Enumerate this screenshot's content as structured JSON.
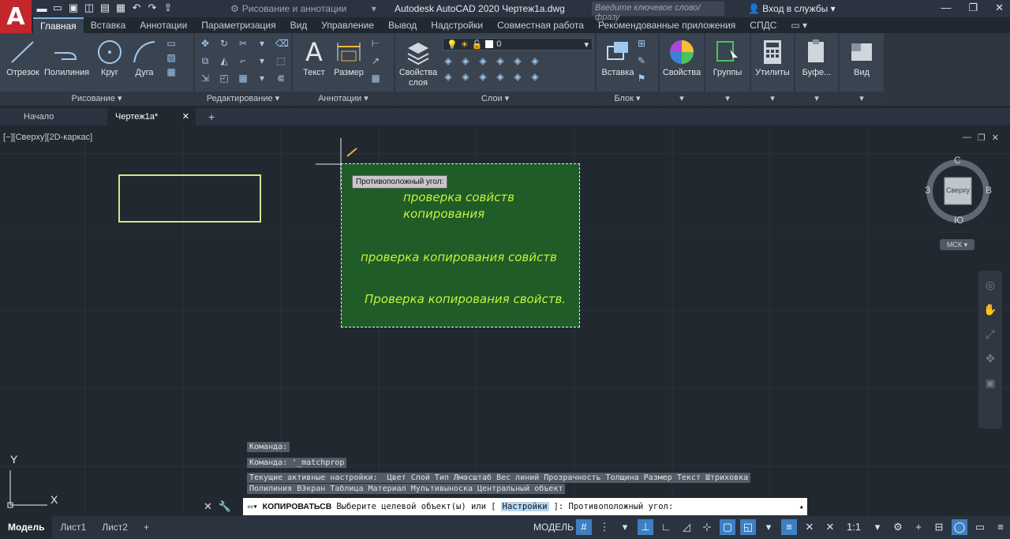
{
  "app": {
    "logo_letter": "A",
    "workspace": "Рисование и аннотации",
    "title": "Autodesk AutoCAD 2020   Чертеж1a.dwg",
    "search_placeholder": "Введите ключевое слово/фразу",
    "login": "Вход в службы"
  },
  "ribbon_tabs": [
    "Главная",
    "Вставка",
    "Аннотации",
    "Параметризация",
    "Вид",
    "Управление",
    "Вывод",
    "Надстройки",
    "Совместная работа",
    "Рекомендованные приложения",
    "СПДС"
  ],
  "ribbon": {
    "draw": {
      "title": "Рисование",
      "tools": [
        "Отрезок",
        "Полилиния",
        "Круг",
        "Дуга"
      ]
    },
    "modify": {
      "title": "Редактирование"
    },
    "annotation": {
      "title": "Аннотации",
      "tools": [
        "Текст",
        "Размер"
      ]
    },
    "layers": {
      "title": "Слои",
      "props_label": "Свойства слоя",
      "current_layer": "0"
    },
    "block": {
      "title": "Блок",
      "insert": "Вставка"
    },
    "properties": {
      "label": "Свойства"
    },
    "groups": {
      "label": "Группы"
    },
    "utilities": {
      "label": "Утилиты"
    },
    "clipboard": {
      "label": "Буфе..."
    },
    "view": {
      "label": "Вид"
    }
  },
  "doc_tabs": {
    "start": "Начало",
    "current": "Чертеж1a*"
  },
  "viewport": {
    "label": "[−][Сверху][2D-каркас]",
    "tooltip": "Противоположный угол:",
    "texts": [
      "проверка совйств копирования",
      "проверка копирования совйств",
      "Проверка копирования свойств."
    ],
    "viewcube": {
      "north": "С",
      "south": "Ю",
      "west": "З",
      "east": "В",
      "face": "Сверху"
    },
    "ucs": "МСК",
    "axis_x": "X",
    "axis_y": "Y"
  },
  "command": {
    "history": [
      "Команда:",
      "Команда: '_matchprop",
      "Текущие активные настройки:  Цвет Слой Тип Лмасштаб Вес линий Прозрачность Толщина Размер Текст Штриховка",
      "Полилиния ВЭкран Таблица Материал Мультивыноска Центральный объект"
    ],
    "name": "КОПИРОВАТЬСВ",
    "prompt_pre": "Выберите целевой объект(ы) или [",
    "option": "Настройки",
    "prompt_post": "]: Противоположный угол:"
  },
  "status": {
    "layouts": [
      "Модель",
      "Лист1",
      "Лист2"
    ],
    "space": "МОДЕЛЬ",
    "scale": "1:1"
  }
}
